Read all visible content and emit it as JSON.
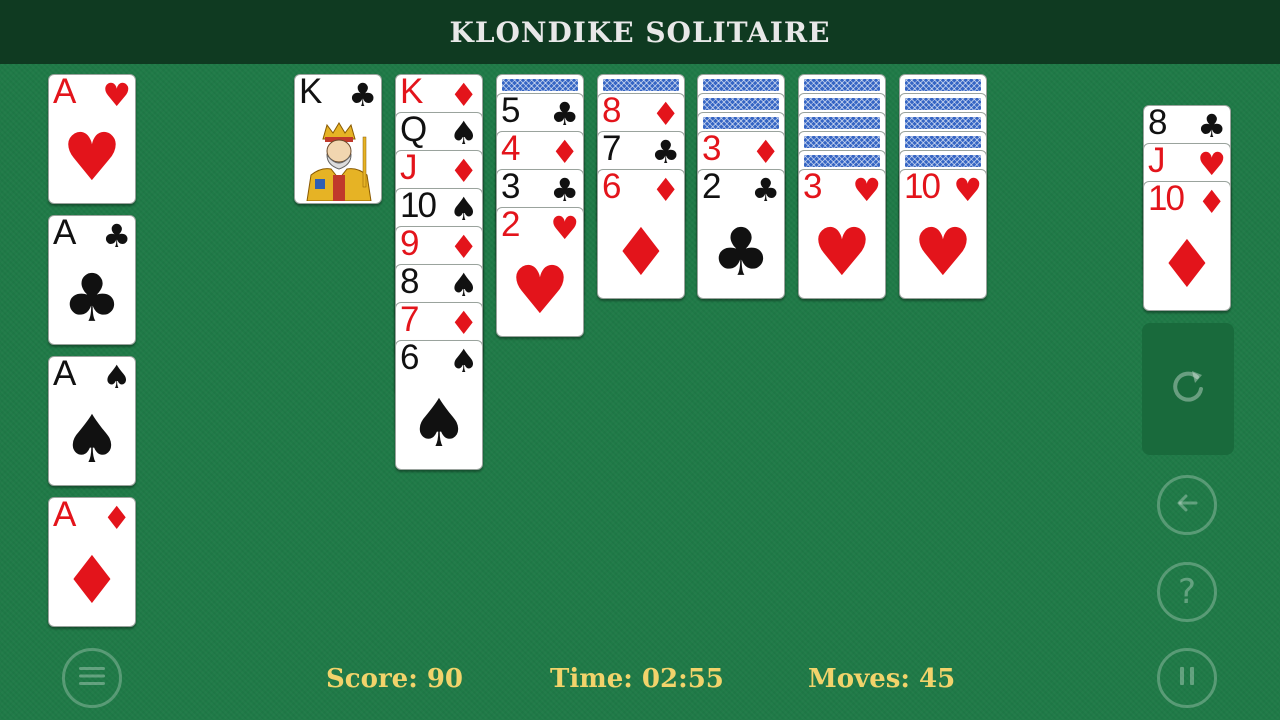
{
  "header": {
    "title": "KLONDIKE SOLITAIRE"
  },
  "foundations": [
    {
      "rank": "A",
      "suit": "♥",
      "color": "red"
    },
    {
      "rank": "A",
      "suit": "♣",
      "color": "black"
    },
    {
      "rank": "A",
      "suit": "♠",
      "color": "black"
    },
    {
      "rank": "A",
      "suit": "♦",
      "color": "red"
    }
  ],
  "tableau": [
    {
      "face_down": 0,
      "cards": [
        {
          "rank": "K",
          "suit": "♣",
          "color": "black",
          "face": true
        }
      ]
    },
    {
      "face_down": 0,
      "cards": [
        {
          "rank": "K",
          "suit": "♦",
          "color": "red"
        },
        {
          "rank": "Q",
          "suit": "♠",
          "color": "black"
        },
        {
          "rank": "J",
          "suit": "♦",
          "color": "red"
        },
        {
          "rank": "10",
          "suit": "♠",
          "color": "black"
        },
        {
          "rank": "9",
          "suit": "♦",
          "color": "red"
        },
        {
          "rank": "8",
          "suit": "♠",
          "color": "black"
        },
        {
          "rank": "7",
          "suit": "♦",
          "color": "red"
        },
        {
          "rank": "6",
          "suit": "♠",
          "color": "black"
        }
      ]
    },
    {
      "face_down": 1,
      "cards": [
        {
          "rank": "5",
          "suit": "♣",
          "color": "black"
        },
        {
          "rank": "4",
          "suit": "♦",
          "color": "red"
        },
        {
          "rank": "3",
          "suit": "♣",
          "color": "black"
        },
        {
          "rank": "2",
          "suit": "♥",
          "color": "red"
        }
      ]
    },
    {
      "face_down": 1,
      "cards": [
        {
          "rank": "8",
          "suit": "♦",
          "color": "red"
        },
        {
          "rank": "7",
          "suit": "♣",
          "color": "black"
        },
        {
          "rank": "6",
          "suit": "♦",
          "color": "red"
        }
      ]
    },
    {
      "face_down": 3,
      "cards": [
        {
          "rank": "3",
          "suit": "♦",
          "color": "red"
        },
        {
          "rank": "2",
          "suit": "♣",
          "color": "black"
        }
      ]
    },
    {
      "face_down": 5,
      "cards": [
        {
          "rank": "3",
          "suit": "♥",
          "color": "red"
        }
      ]
    },
    {
      "face_down": 5,
      "cards": [
        {
          "rank": "10",
          "suit": "♥",
          "color": "red"
        }
      ]
    }
  ],
  "waste": [
    {
      "rank": "8",
      "suit": "♣",
      "color": "black"
    },
    {
      "rank": "J",
      "suit": "♥",
      "color": "red"
    },
    {
      "rank": "10",
      "suit": "♦",
      "color": "red"
    }
  ],
  "controls": {
    "stock_icon": "refresh-icon",
    "undo_icon": "undo-arrow-icon",
    "help_icon": "question-mark-icon",
    "pause_icon": "pause-icon",
    "menu_icon": "hamburger-menu-icon"
  },
  "status": {
    "score_label": "Score: 90",
    "time_label": "Time: 02:55",
    "moves_label": "Moves: 45"
  },
  "colors": {
    "felt": "#1f7a47",
    "header": "#0f3a21",
    "status_text": "#f2d36b",
    "red_suit": "#e3141b",
    "card_back": "#3565c4"
  }
}
